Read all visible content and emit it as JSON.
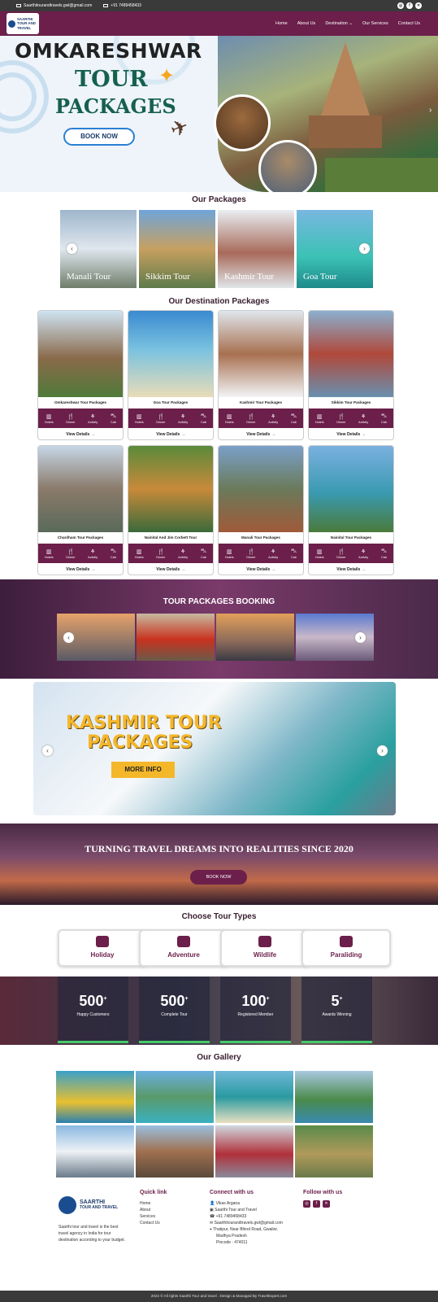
{
  "topbar": {
    "email": "Saarthitourandtravels.gwl@gmail.com",
    "phone": "+91 7489458433"
  },
  "brand": {
    "line1": "SAARTHI",
    "line2": "TOUR AND TRAVEL"
  },
  "nav": {
    "items": [
      "Home",
      "About Us",
      "Destination",
      "Our Services",
      "Contact Us"
    ]
  },
  "hero": {
    "title": "OMKARESHWAR",
    "sub1": "TOUR",
    "sub2": "PACKAGES",
    "cta": "BOOK NOW"
  },
  "packages": {
    "heading": "Our Packages",
    "items": [
      "Manali Tour",
      "Sikkim Tour",
      "Kashmir Tour",
      "Goa Tour"
    ]
  },
  "destinations": {
    "heading": "Our Destination Packages",
    "features": [
      "Hotels",
      "Dinner",
      "Activity",
      "Cab"
    ],
    "view": "View Details →",
    "items": [
      "Omkareshwar Tour Packages",
      "Goa Tour Packages",
      "Kashmir Tour Packages",
      "Sikkim Tour Packages",
      "Chardham Tour Packages",
      "Nainital And Jim Corbett Tour",
      "Manali Tour Packages",
      "Nainital Tour Packages"
    ]
  },
  "booking": {
    "heading": "TOUR PACKAGES BOOKING"
  },
  "kashmir": {
    "line1": "KASHMIR TOUR",
    "line2": "PACKAGES",
    "cta": "MORE INFO"
  },
  "dreams": {
    "heading": "TURNING TRAVEL DREAMS INTO REALITIES SINCE 2020",
    "cta": "BOOK NOW"
  },
  "types": {
    "heading": "Choose Tour Types",
    "items": [
      "Holiday",
      "Adventure",
      "Wildlife",
      "Paraliding"
    ]
  },
  "stats": [
    {
      "n": "500",
      "l": "Happy Customers"
    },
    {
      "n": "500",
      "l": "Complete Tour"
    },
    {
      "n": "100",
      "l": "Registered Member"
    },
    {
      "n": "5",
      "l": "Awards Winning"
    }
  ],
  "gallery": {
    "heading": "Our Gallery"
  },
  "footer": {
    "about": "Saarthi tour and travel is the best travel agency in India for tour destination according to your budget.",
    "quick": {
      "title": "Quick link",
      "links": [
        "Home",
        "About",
        "Services",
        "Contact Us"
      ]
    },
    "connect": {
      "title": "Connect with us",
      "lines": [
        "Vikas Argana",
        "Saarthi Tour and Travel",
        "+91 7489458433",
        "Saarthitourandtravels.gwl@gmail.com",
        "Thatipur, Near Bhind Road, Gwalior,",
        "Madhya Pradesh",
        "Pincode : 474011"
      ]
    },
    "follow": {
      "title": "Follow with us"
    }
  },
  "copyright": "2024 © All rights Saarthi Tour and travel . Design & Managed By TravelExpert.com"
}
